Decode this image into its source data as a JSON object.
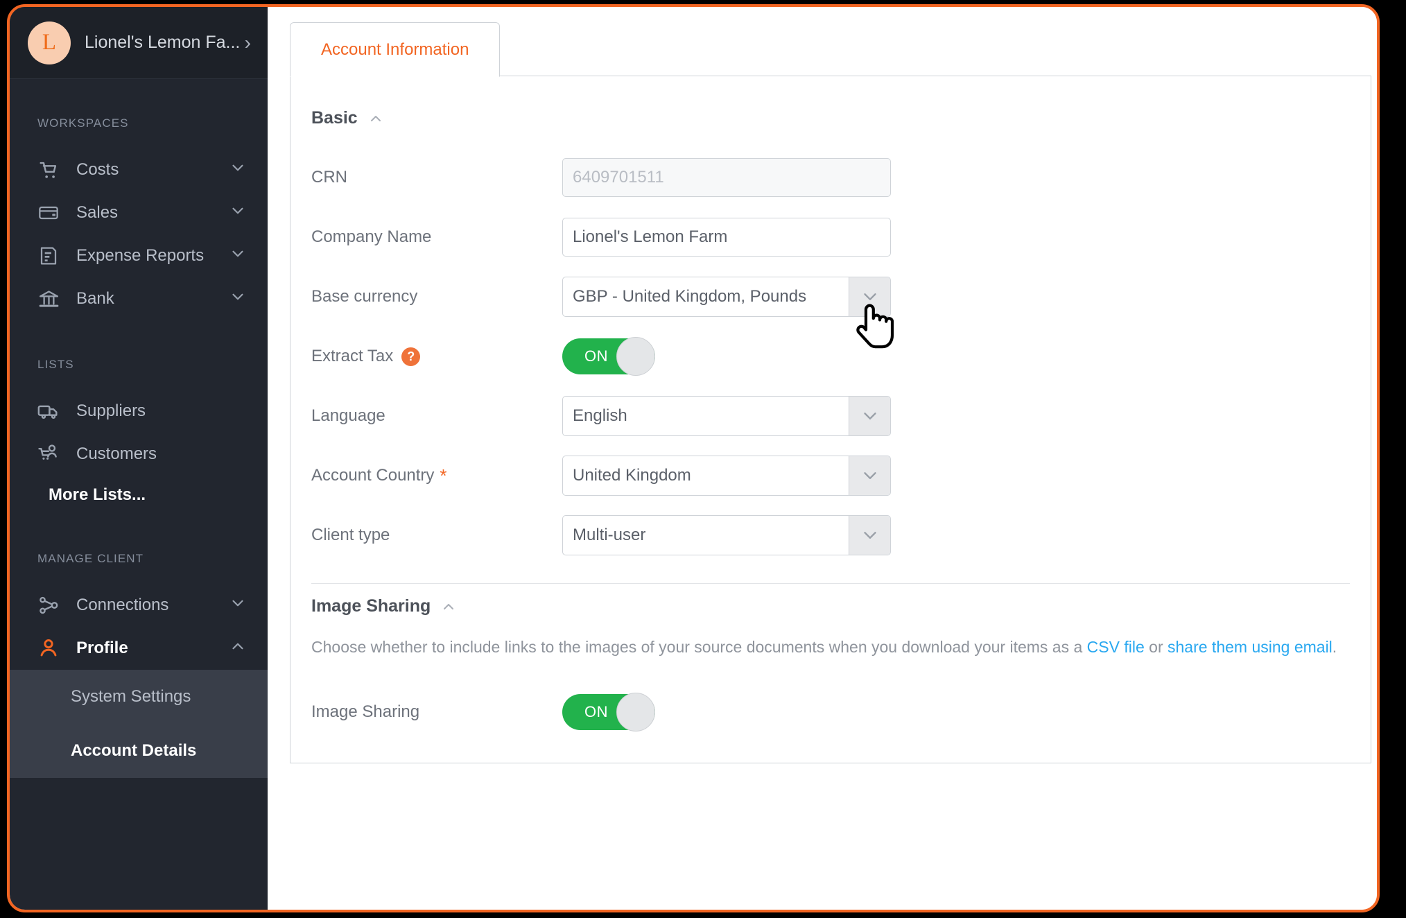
{
  "sidebar": {
    "brand": {
      "initial": "L",
      "name": "Lionel's Lemon Fa...",
      "chevron": "›"
    },
    "sections": [
      {
        "title": "WORKSPACES",
        "items": [
          {
            "label": "Costs",
            "icon": "cart-icon",
            "chevron": "⌄"
          },
          {
            "label": "Sales",
            "icon": "card-icon",
            "chevron": "⌄"
          },
          {
            "label": "Expense Reports",
            "icon": "report-icon",
            "chevron": "⌄"
          },
          {
            "label": "Bank",
            "icon": "bank-icon",
            "chevron": "⌄"
          }
        ]
      },
      {
        "title": "LISTS",
        "items": [
          {
            "label": "Suppliers",
            "icon": "truck-icon",
            "chevron": ""
          },
          {
            "label": "Customers",
            "icon": "customer-cart-icon",
            "chevron": ""
          }
        ],
        "more": "More Lists..."
      },
      {
        "title": "MANAGE CLIENT",
        "items": [
          {
            "label": "Connections",
            "icon": "connections-icon",
            "chevron": "⌄"
          },
          {
            "label": "Profile",
            "icon": "person-icon",
            "chevron": "⌃",
            "active": true
          }
        ],
        "submenu": [
          {
            "label": "System Settings",
            "current": false
          },
          {
            "label": "Account Details",
            "current": true
          }
        ]
      }
    ]
  },
  "main": {
    "tab": {
      "label": "Account Information"
    },
    "basic": {
      "heading": "Basic",
      "caret": "⌃",
      "fields": {
        "crn": {
          "label": "CRN",
          "value": "6409701511",
          "readonly": true
        },
        "company_name": {
          "label": "Company Name",
          "value": "Lionel's Lemon Farm"
        },
        "base_currency": {
          "label": "Base currency",
          "value": "GBP - United Kingdom, Pounds"
        },
        "extract_tax": {
          "label": "Extract Tax",
          "help": "?",
          "toggle": "ON"
        },
        "language": {
          "label": "Language",
          "value": "English"
        },
        "account_country": {
          "label": "Account Country",
          "required": "*",
          "value": "United Kingdom"
        },
        "client_type": {
          "label": "Client type",
          "value": "Multi-user"
        }
      }
    },
    "image_sharing": {
      "heading": "Image Sharing",
      "caret": "⌃",
      "description_part1": "Choose whether to include links to the images of your source documents when you download your items as a ",
      "link_csv": "CSV file",
      "description_part2": " or ",
      "link_email": "share them using email",
      "description_part3": ".",
      "toggle_label": "Image Sharing",
      "toggle": "ON"
    }
  },
  "colors": {
    "accent": "#f26522",
    "toggle_on": "#22b24c",
    "link": "#29a8f0",
    "sidebar_bg": "#22262f"
  }
}
